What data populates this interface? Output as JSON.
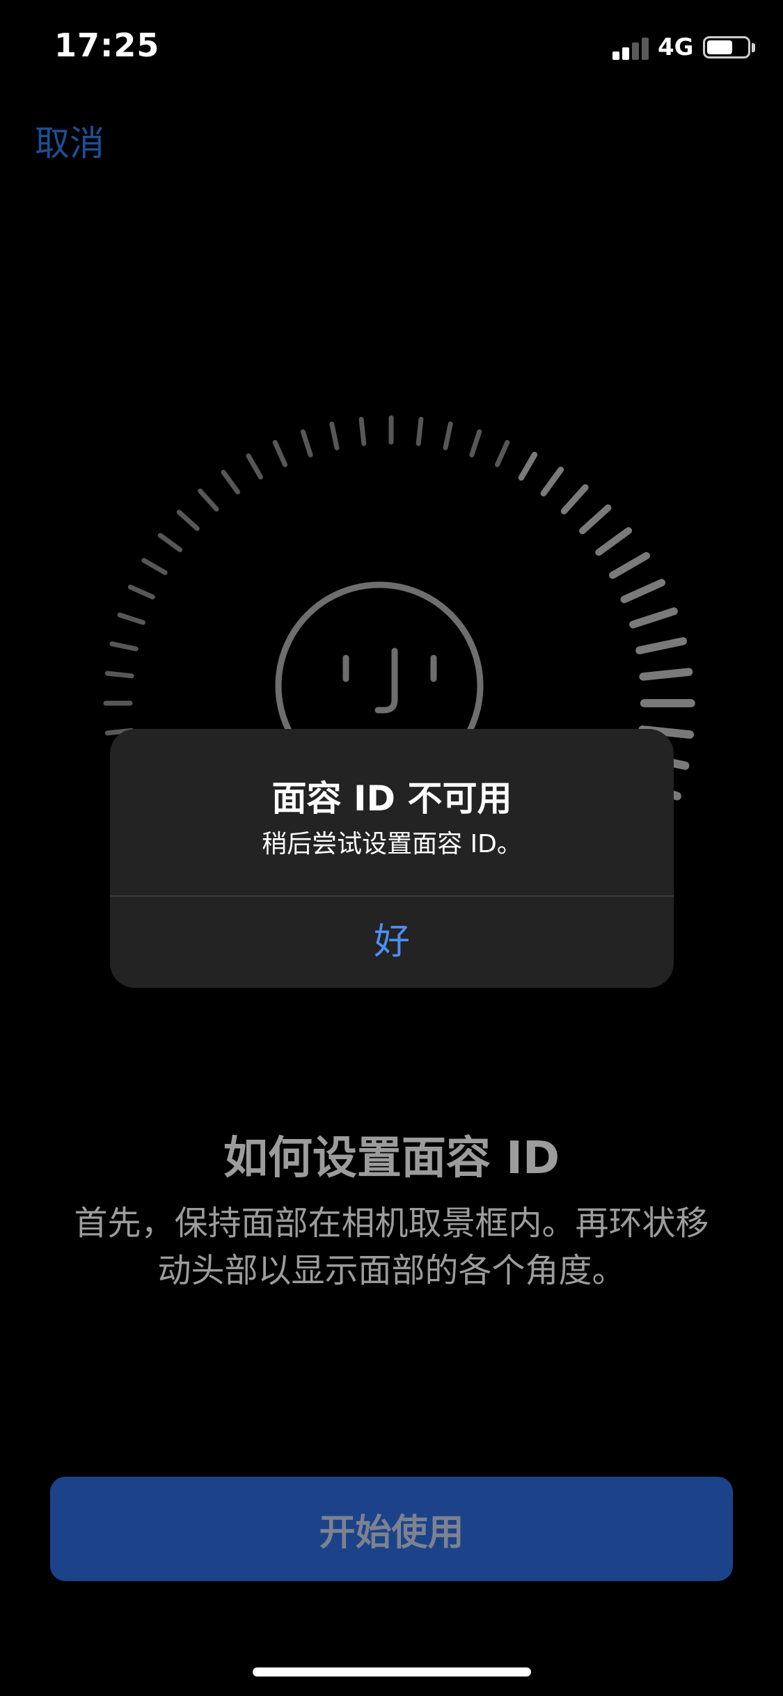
{
  "status_bar": {
    "time": "17:25",
    "network": "4G",
    "signal_bars": 4,
    "signal_active_bars": 2,
    "battery_level": 0.65
  },
  "nav": {
    "cancel_label": "取消"
  },
  "scanner": {
    "icon": "face-id-icon"
  },
  "alert": {
    "title": "面容 ID 不可用",
    "message": "稍后尝试设置面容 ID。",
    "ok_label": "好"
  },
  "content": {
    "heading": "如何设置面容 ID",
    "description": "首先，保持面部在相机取景框内。再环状移动头部以显示面部的各个角度。"
  },
  "actions": {
    "start_label": "开始使用"
  },
  "colors": {
    "background": "#000000",
    "link_blue": "#1d4f96",
    "alert_bg": "#232323",
    "alert_button": "#4c8ff0",
    "primary_button": "#1c438a",
    "muted_text": "#9c9c9c"
  }
}
